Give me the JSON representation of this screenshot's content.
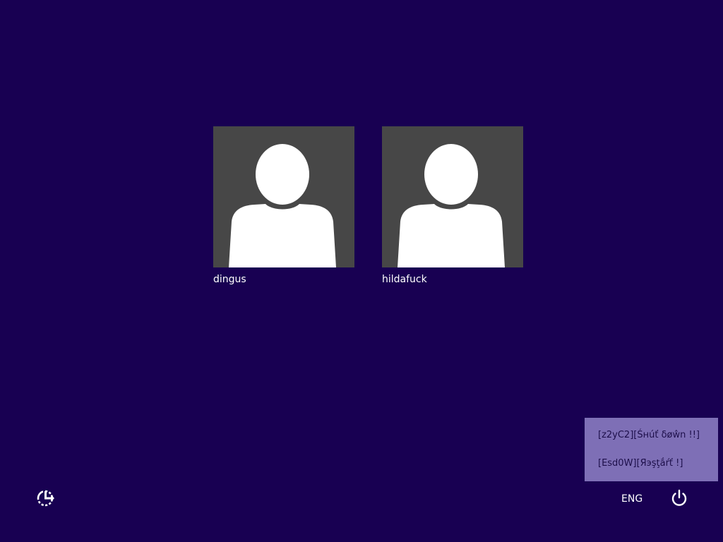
{
  "users": [
    {
      "name": "dingus"
    },
    {
      "name": "hildafuck"
    }
  ],
  "power_menu": {
    "items": [
      {
        "label": "[z2yC2][Śнúť δøŵn !!]"
      },
      {
        "label": "[Esd0W][Яэşţắŕť !]"
      }
    ]
  },
  "bottom_bar": {
    "ease_of_access_icon": "ease-of-access-icon",
    "language": "ENG",
    "power_icon": "power-icon"
  },
  "colors": {
    "background": "#180052",
    "avatar_bg": "#474747",
    "menu_bg": "#7e6fb6",
    "menu_text": "#1d0f4a"
  }
}
